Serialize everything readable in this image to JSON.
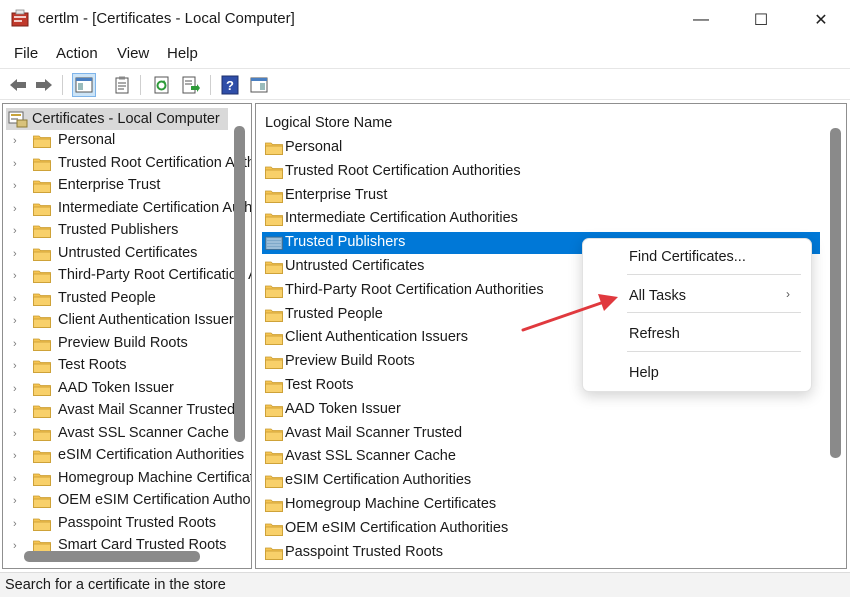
{
  "window": {
    "title": "certlm - [Certificates - Local Computer]",
    "minimize_glyph": "—",
    "maximize_glyph": "☐",
    "close_glyph": "✕"
  },
  "menu": [
    "File",
    "Action",
    "View",
    "Help"
  ],
  "toolbar": {
    "icons": [
      "back-icon",
      "forward-icon",
      "show-hide-tree-icon",
      "properties-icon",
      "refresh-icon",
      "export-list-icon",
      "help-icon",
      "show-action-pane-icon"
    ]
  },
  "tree": {
    "root": "Certificates - Local Computer",
    "items": [
      "Personal",
      "Trusted Root Certification Authorities",
      "Enterprise Trust",
      "Intermediate Certification Authorities",
      "Trusted Publishers",
      "Untrusted Certificates",
      "Third-Party Root Certification Authorities",
      "Trusted People",
      "Client Authentication Issuers",
      "Preview Build Roots",
      "Test Roots",
      "AAD Token Issuer",
      "Avast Mail Scanner Trusted",
      "Avast SSL Scanner Cache",
      "eSIM Certification Authorities",
      "Homegroup Machine Certificates",
      "OEM eSIM Certification Authorities",
      "Passpoint Trusted Roots",
      "Smart Card Trusted Roots"
    ]
  },
  "list": {
    "header": "Logical Store Name",
    "selected_index": 4,
    "items": [
      "Personal",
      "Trusted Root Certification Authorities",
      "Enterprise Trust",
      "Intermediate Certification Authorities",
      "Trusted Publishers",
      "Untrusted Certificates",
      "Third-Party Root Certification Authorities",
      "Trusted People",
      "Client Authentication Issuers",
      "Preview Build Roots",
      "Test Roots",
      "AAD Token Issuer",
      "Avast Mail Scanner Trusted",
      "Avast SSL Scanner Cache",
      "eSIM Certification Authorities",
      "Homegroup Machine Certificates",
      "OEM eSIM Certification Authorities",
      "Passpoint Trusted Roots"
    ]
  },
  "context_menu": {
    "items": [
      "Find Certificates...",
      "All Tasks",
      "Refresh",
      "Help"
    ],
    "submenu_glyph": "›"
  },
  "status": "Search for a certificate in the store",
  "colors": {
    "selection": "#0078d7",
    "annotation_arrow": "#e0393e",
    "folder": "#f5c452"
  }
}
